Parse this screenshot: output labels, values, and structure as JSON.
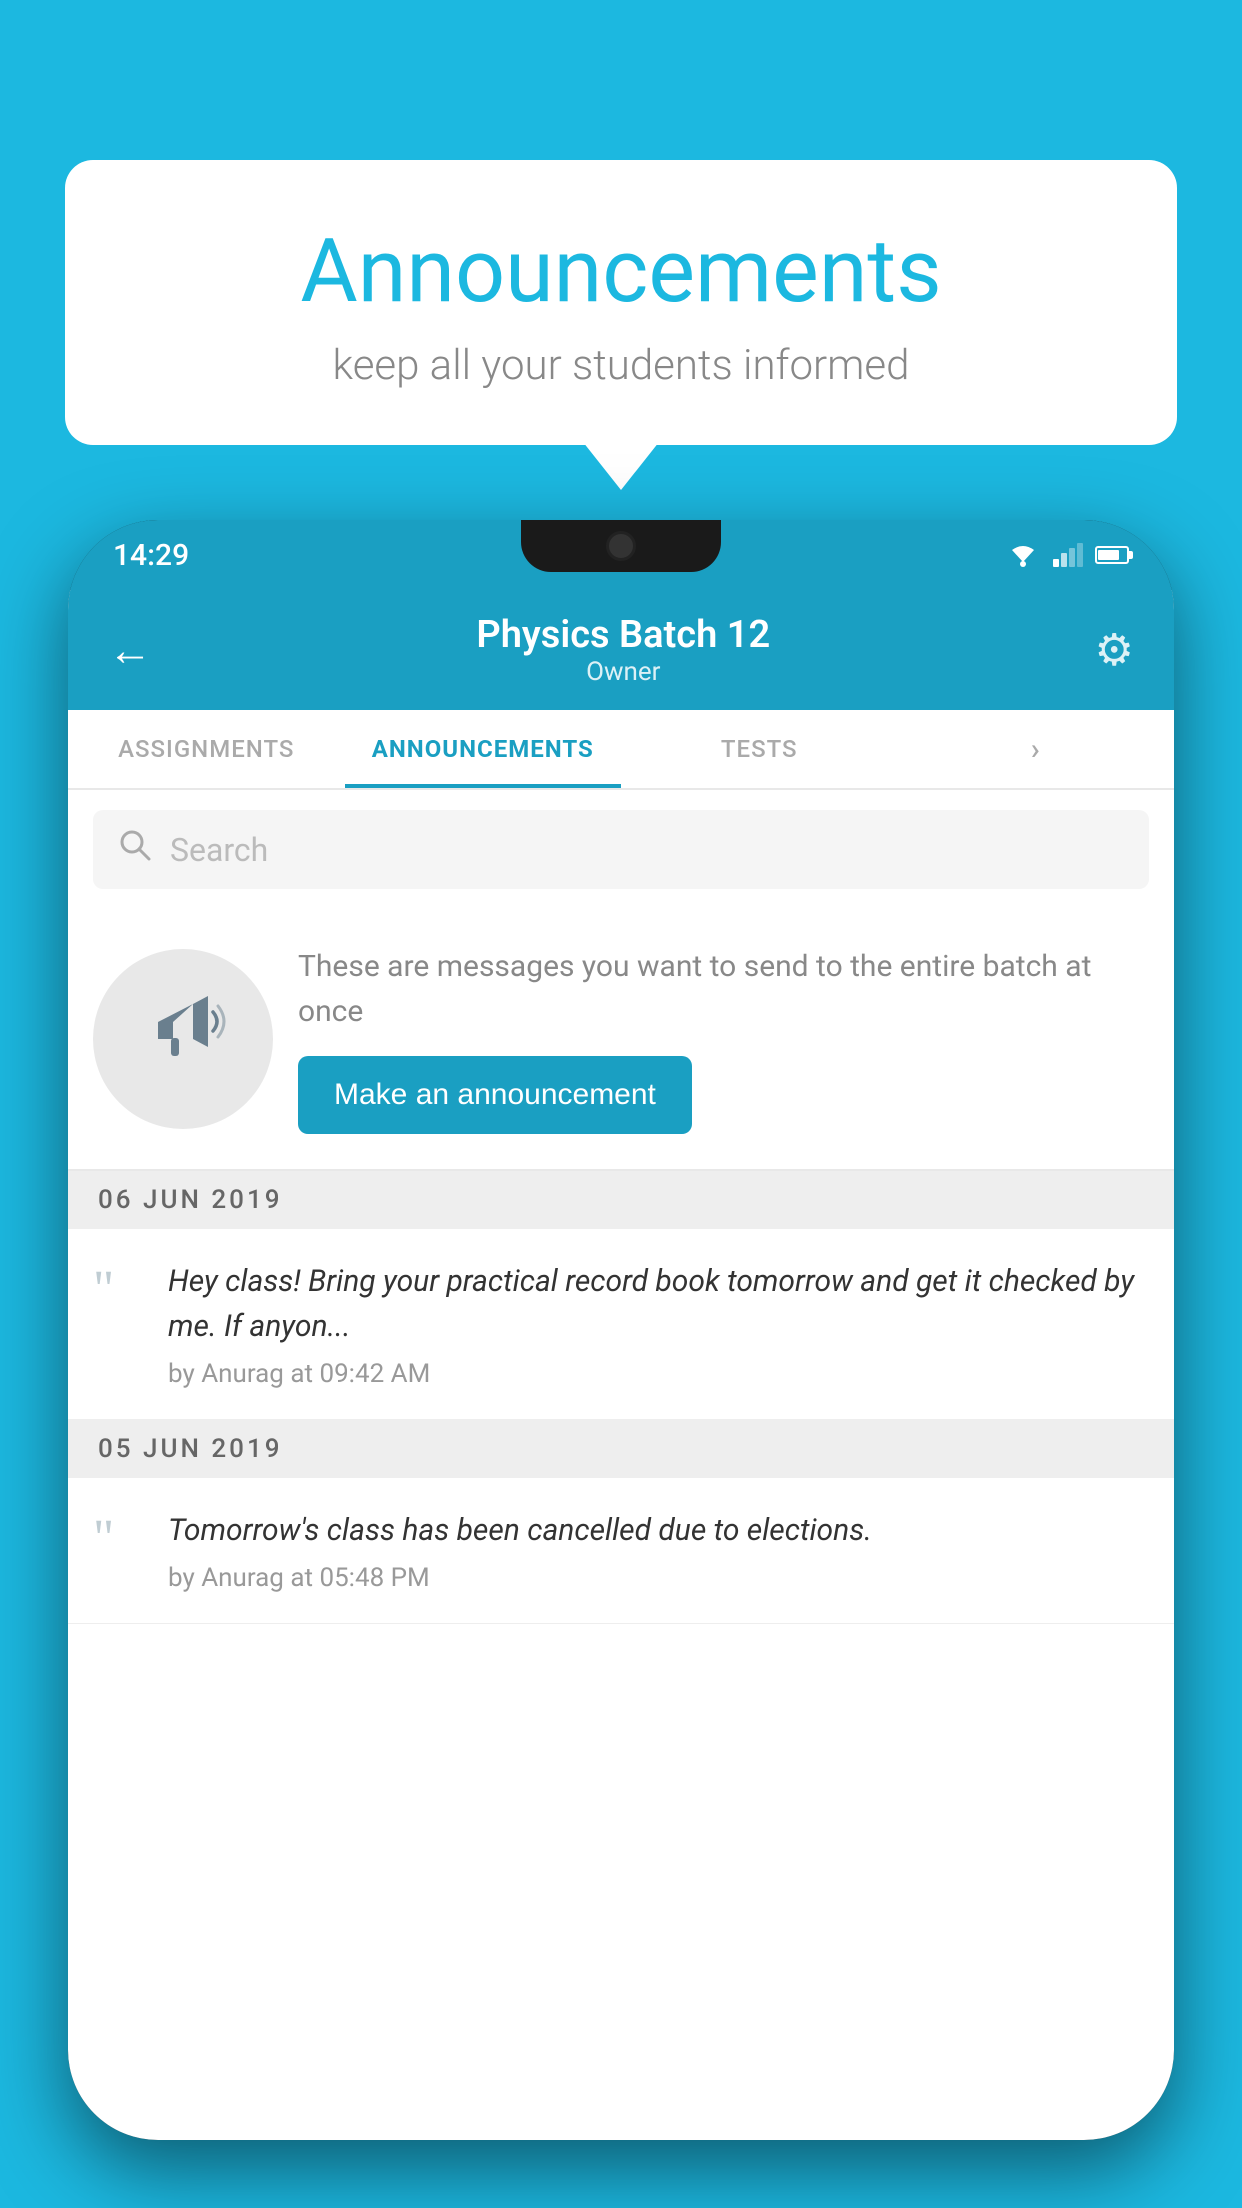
{
  "background_color": "#1cb8e0",
  "speech_bubble": {
    "title": "Announcements",
    "subtitle": "keep all your students informed"
  },
  "status_bar": {
    "time": "14:29",
    "wifi_icon": "wifi",
    "signal_icon": "signal",
    "battery_icon": "battery"
  },
  "header": {
    "back_label": "←",
    "title": "Physics Batch 12",
    "subtitle": "Owner",
    "settings_icon": "⚙"
  },
  "tabs": [
    {
      "label": "ASSIGNMENTS",
      "active": false
    },
    {
      "label": "ANNOUNCEMENTS",
      "active": true
    },
    {
      "label": "TESTS",
      "active": false
    },
    {
      "label": "...",
      "active": false
    }
  ],
  "search": {
    "placeholder": "Search",
    "icon": "🔍"
  },
  "promo": {
    "text": "These are messages you want to send to the entire batch at once",
    "button_label": "Make an announcement"
  },
  "announcements": [
    {
      "date_separator": "06  JUN  2019",
      "text": "Hey class! Bring your practical record book tomorrow and get it checked by me. If anyon...",
      "meta": "by Anurag at 09:42 AM"
    },
    {
      "date_separator": "05  JUN  2019",
      "text": "Tomorrow's class has been cancelled due to elections.",
      "meta": "by Anurag at 05:48 PM"
    }
  ]
}
